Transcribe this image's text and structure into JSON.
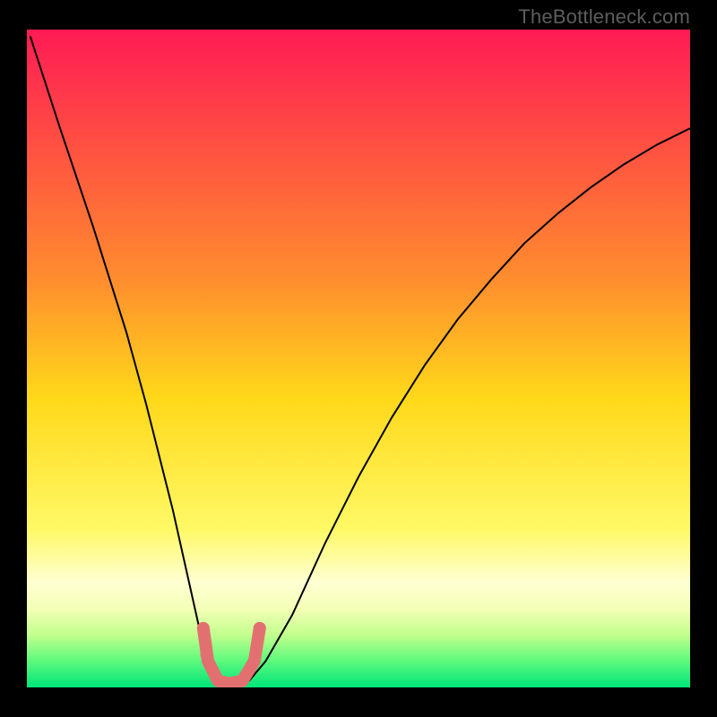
{
  "watermark": "TheBottleneck.com",
  "chart_data": {
    "type": "line",
    "title": "",
    "xlabel": "",
    "ylabel": "",
    "xlim": [
      0,
      100
    ],
    "ylim": [
      0,
      100
    ],
    "grid": false,
    "background_gradient": {
      "stops": [
        {
          "y": 0,
          "color": "#ff1b54"
        },
        {
          "y": 38,
          "color": "#ff8d2e"
        },
        {
          "y": 56,
          "color": "#ffd81a"
        },
        {
          "y": 76,
          "color": "#fff966"
        },
        {
          "y": 84,
          "color": "#ffffd3"
        },
        {
          "y": 88,
          "color": "#f4ffb6"
        },
        {
          "y": 92,
          "color": "#c3ff8e"
        },
        {
          "y": 96,
          "color": "#5cf97c"
        },
        {
          "y": 100,
          "color": "#00e47a"
        }
      ]
    },
    "series": [
      {
        "name": "bottleneck-curve",
        "color": "#000000",
        "stroke_width": 2,
        "x": [
          0.5,
          5,
          10,
          15,
          18,
          20,
          22,
          24,
          26,
          27.5,
          29,
          31,
          33.5,
          36,
          40,
          45,
          50,
          55,
          60,
          65,
          70,
          75,
          80,
          85,
          90,
          95,
          100
        ],
        "y": [
          99,
          85,
          70,
          54,
          43,
          35,
          27,
          18,
          9,
          4,
          1,
          0.5,
          1,
          4,
          11,
          22,
          32,
          41,
          49,
          56,
          62,
          67.5,
          72,
          76,
          79.5,
          82.5,
          85
        ]
      },
      {
        "name": "optimal-marker",
        "color": "#e37070",
        "stroke_width": 14,
        "linecap": "round",
        "x": [
          26.6,
          27.3,
          28.8,
          30.5,
          32.5,
          34.3,
          35.1
        ],
        "y": [
          9,
          4,
          1,
          0.6,
          1,
          4,
          9
        ]
      }
    ],
    "markers": [
      {
        "name": "optimal-dot-left-a",
        "x": 26.6,
        "y": 9,
        "r": 7,
        "color": "#e37070"
      },
      {
        "name": "optimal-dot-left-b",
        "x": 27.1,
        "y": 5,
        "r": 7,
        "color": "#e37070"
      },
      {
        "name": "optimal-dot-right",
        "x": 35.1,
        "y": 9,
        "r": 7,
        "color": "#e37070"
      }
    ]
  }
}
